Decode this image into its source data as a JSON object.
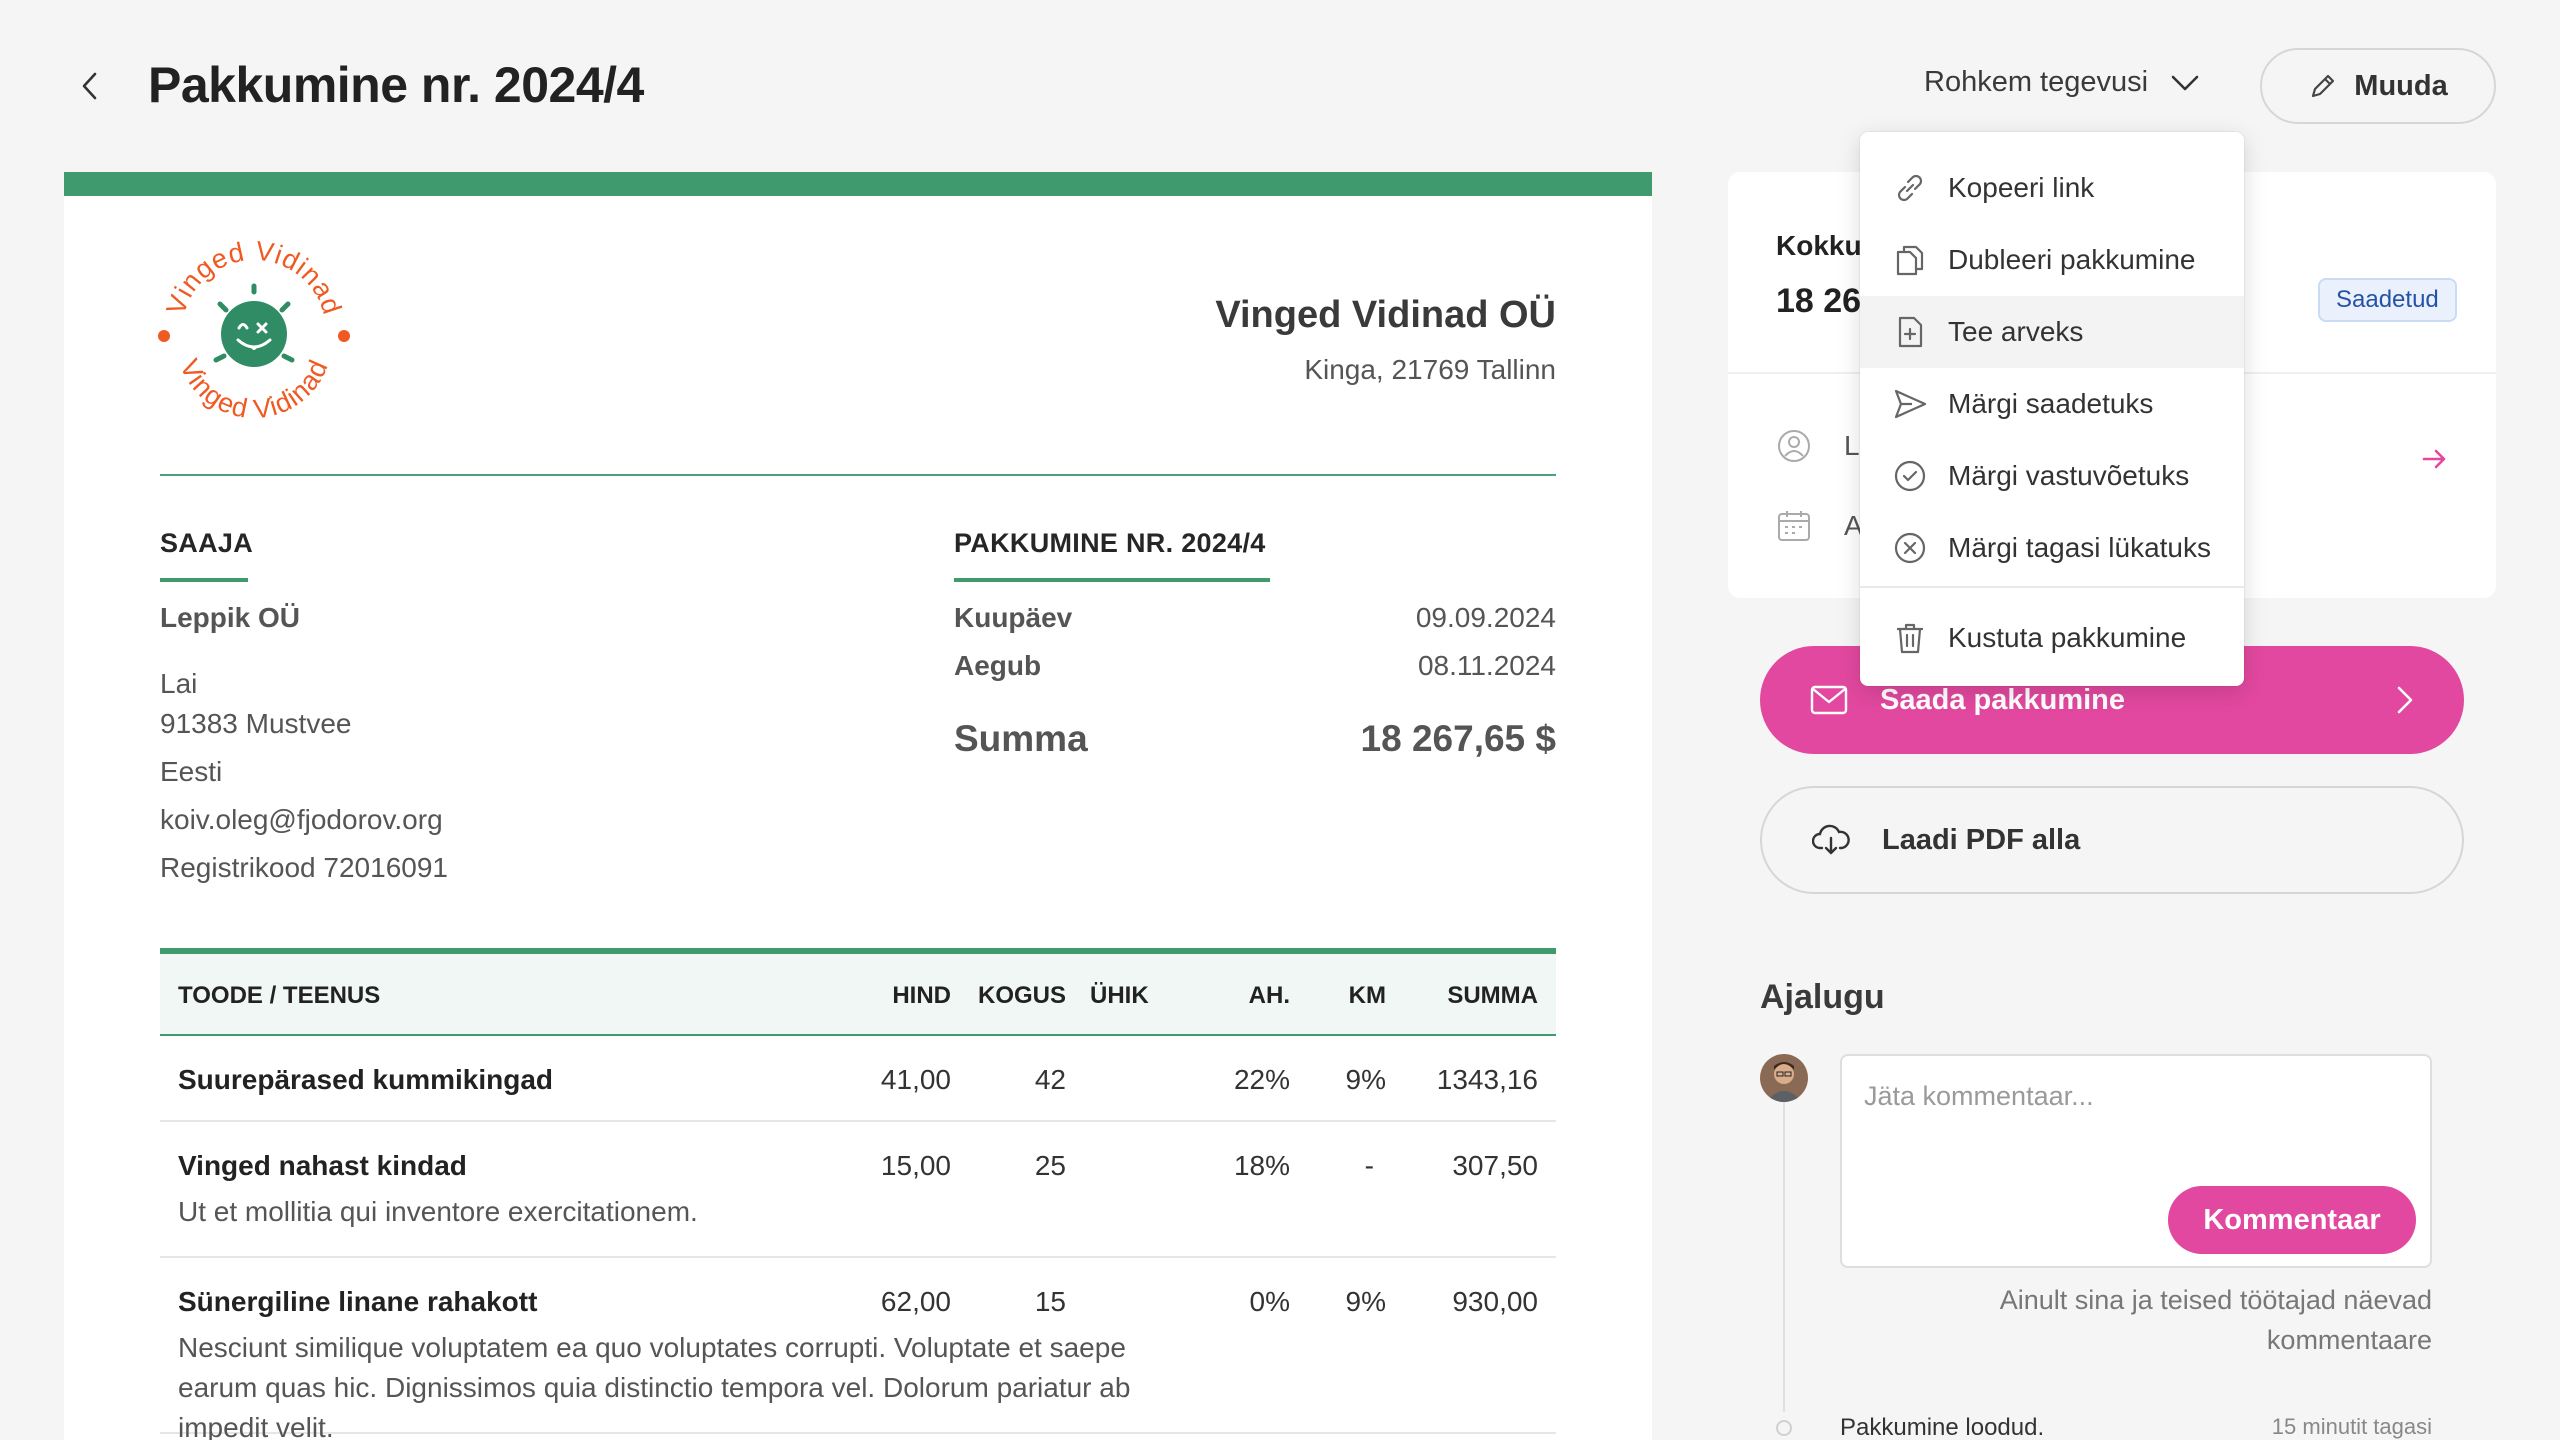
{
  "header": {
    "title": "Pakkumine nr. 2024/4",
    "more_actions_label": "Rohkem tegevusi",
    "edit_label": "Muuda"
  },
  "dropdown": {
    "items": [
      {
        "label": "Kopeeri link",
        "icon": "link-icon"
      },
      {
        "label": "Dubleeri pakkumine",
        "icon": "copy-icon"
      },
      {
        "label": "Tee arveks",
        "icon": "file-plus-icon"
      },
      {
        "label": "Märgi saadetuks",
        "icon": "send-icon"
      },
      {
        "label": "Märgi vastuvõetuks",
        "icon": "check-circle-icon"
      },
      {
        "label": "Märgi tagasi lükatuks",
        "icon": "x-circle-icon"
      },
      {
        "label": "Kustuta pakkumine",
        "icon": "trash-icon"
      }
    ]
  },
  "document": {
    "logo_text": "Vinged Vidinad",
    "company": {
      "name": "Vinged Vidinad OÜ",
      "address": "Kinga, 21769 Tallinn"
    },
    "recipient": {
      "heading": "SAAJA",
      "name": "Leppik OÜ",
      "street": "Lai",
      "city": "91383 Mustvee",
      "country": "Eesti",
      "email": "koiv.oleg@fjodorov.org",
      "reg_code": "Registrikood 72016091"
    },
    "offer": {
      "heading": "PAKKUMINE NR. 2024/4",
      "date_label": "Kuupäev",
      "date_value": "09.09.2024",
      "expires_label": "Aegub",
      "expires_value": "08.11.2024",
      "sum_label": "Summa",
      "sum_value": "18 267,65 $"
    },
    "table": {
      "headers": {
        "product": "TOODE / TEENUS",
        "price": "HIND",
        "qty": "KOGUS",
        "unit": "ÜHIK",
        "discount": "AH.",
        "vat": "KM",
        "total": "SUMMA"
      },
      "rows": [
        {
          "name": "Suurepärased kummikingad",
          "description": "",
          "price": "41,00",
          "qty": "42",
          "unit": "",
          "discount": "22%",
          "vat": "9%",
          "total": "1343,16"
        },
        {
          "name": "Vinged nahast kindad",
          "description": "Ut et mollitia qui inventore exercitationem.",
          "price": "15,00",
          "qty": "25",
          "unit": "",
          "discount": "18%",
          "vat": "-",
          "total": "307,50"
        },
        {
          "name": "Sünergiline linane rahakott",
          "description": "Nesciunt similique voluptatem ea quo voluptates corrupti. Voluptate et saepe earum quas hic. Dignissimos quia distinctio tempora vel. Dolorum pariatur ab impedit velit.",
          "price": "62,00",
          "qty": "15",
          "unit": "",
          "discount": "0%",
          "vat": "9%",
          "total": "930,00"
        }
      ]
    }
  },
  "sidebar": {
    "summary_label": "Kokku",
    "summary_amount": "18 26",
    "status": "Saadetud",
    "row1_text": "L",
    "row2_text": "A",
    "send_label": "Saada pakkumine",
    "pdf_label": "Laadi PDF alla",
    "history_title": "Ajalugu",
    "comment_placeholder": "Jäta kommentaar...",
    "comment_button": "Kommentaar",
    "comment_note": "Ainult sina ja teised töötajad näevad kommentaare",
    "event_text": "Pakkumine loodud.",
    "event_time": "15 minutit tagasi"
  },
  "colors": {
    "brand_green": "#3f9a6e",
    "accent_pink": "#e2489f",
    "logo_orange": "#f05a22"
  }
}
